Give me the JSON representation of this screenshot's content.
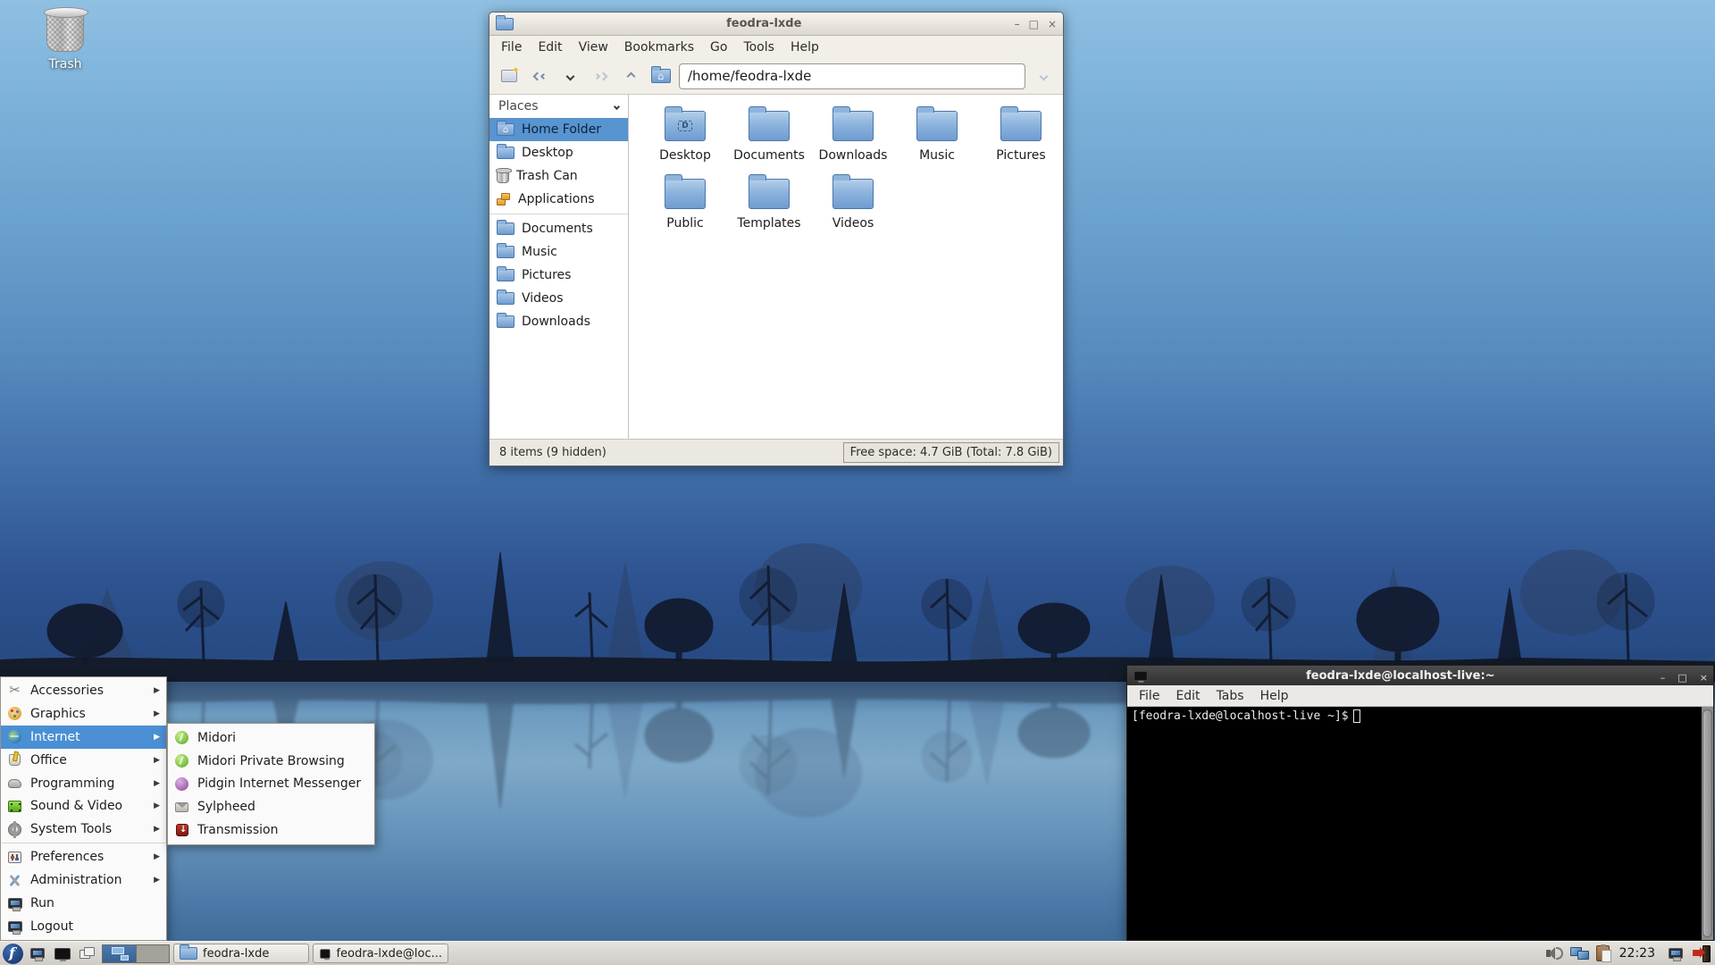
{
  "desktop": {
    "trash_label": "Trash"
  },
  "icons": {
    "window_controls": {
      "minimize": "–",
      "maximize": "□",
      "close": "×"
    },
    "submenu_arrow": "▶",
    "scissors_glyph": "✂",
    "home_glyph": "⌂",
    "desktop_glyph": "D"
  },
  "file_manager": {
    "title": "feodra-lxde",
    "menu": [
      "File",
      "Edit",
      "View",
      "Bookmarks",
      "Go",
      "Tools",
      "Help"
    ],
    "path": "/home/feodra-lxde",
    "sidebar": {
      "header": "Places",
      "items": [
        "Home Folder",
        "Desktop",
        "Trash Can",
        "Applications",
        "Documents",
        "Music",
        "Pictures",
        "Videos",
        "Downloads"
      ],
      "selected": "Home Folder"
    },
    "folders": [
      "Desktop",
      "Documents",
      "Downloads",
      "Music",
      "Pictures",
      "Public",
      "Templates",
      "Videos"
    ],
    "status_left": "8 items (9 hidden)",
    "status_right": "Free space: 4.7 GiB (Total: 7.8 GiB)"
  },
  "start_menu": {
    "items": [
      {
        "label": "Accessories"
      },
      {
        "label": "Graphics"
      },
      {
        "label": "Internet"
      },
      {
        "label": "Office"
      },
      {
        "label": "Programming"
      },
      {
        "label": "Sound & Video"
      },
      {
        "label": "System Tools"
      },
      {
        "label": "Preferences"
      },
      {
        "label": "Administration"
      },
      {
        "label": "Run"
      },
      {
        "label": "Logout"
      }
    ],
    "highlighted": "Internet"
  },
  "internet_submenu": {
    "items": [
      "Midori",
      "Midori Private Browsing",
      "Pidgin Internet Messenger",
      "Sylpheed",
      "Transmission"
    ]
  },
  "terminal": {
    "title": "feodra-lxde@localhost-live:~",
    "menu": [
      "File",
      "Edit",
      "Tabs",
      "Help"
    ],
    "prompt": "[feodra-lxde@localhost-live ~]$"
  },
  "taskbar": {
    "window_buttons": [
      {
        "label": "feodra-lxde"
      },
      {
        "label": "feodra-lxde@loc..."
      }
    ],
    "clock": "22:23"
  },
  "colors": {
    "selection_blue": "#4a8fd4",
    "sidebar_selection": "#5794d0",
    "folder_blue": "#7aa7d6",
    "taskbar_gray": "#d6d3cd",
    "terminal_black": "#000000"
  }
}
